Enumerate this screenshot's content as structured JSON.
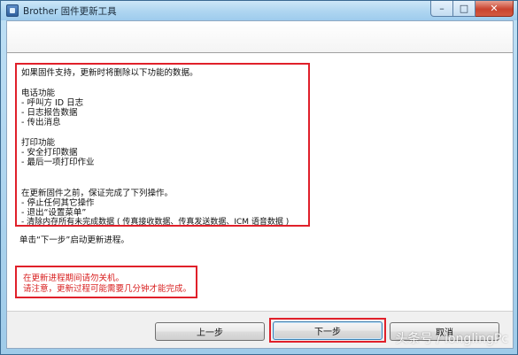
{
  "window": {
    "title": "Brother 固件更新工具"
  },
  "caption_buttons": {
    "minimize": "–",
    "maximize": "□",
    "close": "✕"
  },
  "info": {
    "intro": "如果固件支持，更新时将删除以下功能的数据。",
    "fax_heading": "电话功能",
    "fax_items": [
      "- 呼叫方 ID 日志",
      "- 日志报告数据",
      "- 传出消息"
    ],
    "print_heading": "打印功能",
    "print_items": [
      "- 安全打印数据",
      "- 最后一项打印作业"
    ],
    "before_update": "在更新固件之前，保证完成了下列操作。",
    "before_items": [
      "- 停止任何其它操作",
      "- 退出“设置菜单”",
      "- 清除内存所有未完成数据 ( 传真接收数据、传真发送数据、ICM 语音数据 )"
    ]
  },
  "note": "单击“下一步”启动更新进程。",
  "warnings": [
    "在更新进程期间请勿关机。",
    "请注意，更新过程可能需要几分钟才能完成。"
  ],
  "buttons": {
    "back": "上一步",
    "next": "下一步",
    "cancel": "取消"
  },
  "watermark": "头条号 / longlingPc",
  "colors": {
    "highlight_border": "#e0202a",
    "warning_text": "#d81e1e",
    "title_bar": "#b0d7f1"
  }
}
